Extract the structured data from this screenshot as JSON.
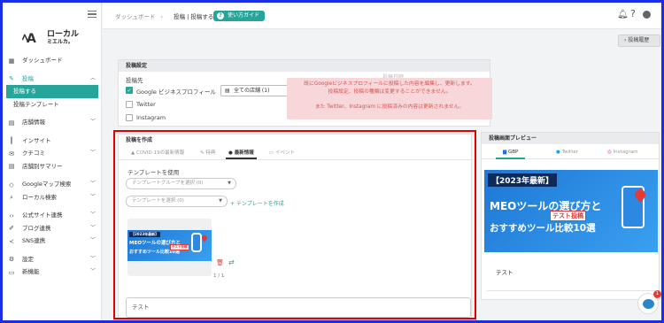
{
  "sidebar": {
    "logo": {
      "mark": "ﾍA",
      "name1": "ローカル",
      "name2": "ミエルカ。"
    },
    "items": [
      {
        "label": "ダッシュボード",
        "icon": "dashboard-icon",
        "glyph": "▦"
      },
      {
        "label": "投稿",
        "icon": "edit-icon",
        "glyph": "✎"
      },
      {
        "label": "投稿する"
      },
      {
        "label": "投稿テンプレート"
      },
      {
        "label": "店舗情報",
        "icon": "store-icon",
        "glyph": "▤"
      },
      {
        "label": "インサイト",
        "icon": "bar-chart-icon",
        "glyph": "┃"
      },
      {
        "label": "クチコミ",
        "icon": "review-icon",
        "glyph": "✉"
      },
      {
        "label": "店舗別サマリー",
        "icon": "summary-icon",
        "glyph": "▤"
      },
      {
        "label": "Googleマップ検索",
        "icon": "map-icon",
        "glyph": "◇"
      },
      {
        "label": "ローカル検索",
        "icon": "local-search-icon",
        "glyph": "⌕"
      },
      {
        "label": "公式サイト連携",
        "icon": "code-icon",
        "glyph": "‹›"
      },
      {
        "label": "ブログ連携",
        "icon": "blog-icon",
        "glyph": "✐"
      },
      {
        "label": "SNS連携",
        "icon": "share-icon",
        "glyph": "≺"
      },
      {
        "label": "設定",
        "icon": "settings-icon",
        "glyph": "⚙"
      },
      {
        "label": "新機能",
        "icon": "new-icon",
        "glyph": "▭"
      }
    ]
  },
  "topbar": {
    "crumb_home": "ダッシュボード",
    "crumb_current": "投稿 | 投稿する",
    "guide_label": "使い方ガイド"
  },
  "history_button": "投稿履歴",
  "settings": {
    "title": "投稿設定",
    "target_label": "投稿先",
    "ghost_label": "投稿日時",
    "options": [
      {
        "label": "Google ビジネスプロフィール",
        "checked": true
      },
      {
        "label": "Twitter",
        "checked": false
      },
      {
        "label": "Instagram",
        "checked": false
      }
    ],
    "store_select": "全ての店舗 (1)",
    "warning_lines": [
      "既にGoogleビジネスプロフィールに投稿した内容を編集し、更新します。",
      "投稿設定、投稿の種類は変更することができません。",
      "",
      "また Twitter、Instagram に投稿済みの内容は更新されません。"
    ]
  },
  "create": {
    "title": "投稿を作成",
    "tabs": [
      {
        "label": "COVID-19の最新情報",
        "glyph": "▲"
      },
      {
        "label": "特典",
        "glyph": "✎"
      },
      {
        "label": "最新情報",
        "glyph": "●"
      },
      {
        "label": "イベント",
        "glyph": "▭"
      }
    ],
    "template_label": "テンプレートを使用",
    "group_placeholder": "テンプレートグループを選択 (0)",
    "template_placeholder": "テンプレートを選択 (0)",
    "add_template": "+ テンプレートを作成",
    "pager": "1 / 1",
    "text_value": "テスト"
  },
  "image": {
    "tag": "【2023年最新】",
    "line1": "MEOツールの選び方と",
    "line2": "おすすめツール比較10選",
    "overlay": "テスト投稿"
  },
  "preview": {
    "title": "投稿画面プレビュー",
    "tabs": [
      "GBP",
      "Twitter",
      "Instagram"
    ],
    "text": "テスト"
  },
  "chat_badge": "1",
  "colors": {
    "accent": "#26a59a",
    "warning_bg": "#f8d7da",
    "warning_text": "#d9534f",
    "frame": "#1a2ee6",
    "highlight": "#e00000"
  }
}
